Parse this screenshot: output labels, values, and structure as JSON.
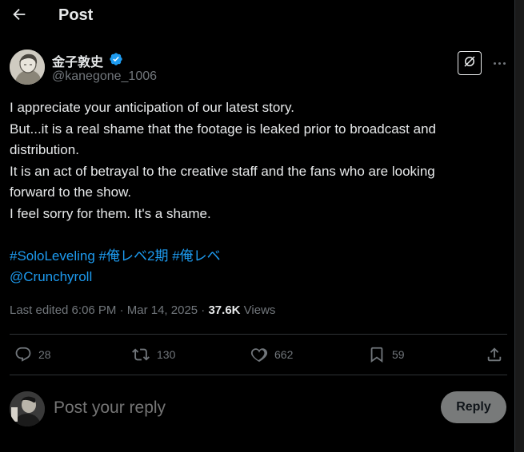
{
  "header": {
    "title": "Post",
    "back_icon": "arrow-left-icon"
  },
  "author": {
    "name": "金子敦史",
    "handle": "@kanegone_1006",
    "verified_color": "#1d9bf0"
  },
  "tweet": {
    "lines": [
      "I appreciate your anticipation of our latest story.",
      "But...it is a real shame that the footage is leaked prior to broadcast and",
      "distribution.",
      "It is an act of betrayal to the creative staff and the fans who are looking",
      "forward to the show.",
      "I feel sorry for them. It's a shame."
    ],
    "hashtags": [
      "#SoloLeveling",
      "#俺レベ2期",
      "#俺レベ"
    ],
    "mention": "@Crunchyroll"
  },
  "meta": {
    "edited": "Last edited 6:06 PM · Mar 14, 2025 · ",
    "views_count": "37.6K",
    "views_label": " Views"
  },
  "actions": {
    "replies": "28",
    "reposts": "130",
    "likes": "662",
    "bookmarks": "59"
  },
  "reply": {
    "placeholder": "Post your reply",
    "button_label": "Reply"
  },
  "colors": {
    "background": "#000000",
    "text": "#e7e9ea",
    "muted": "#71767b",
    "link": "#1d9bf0",
    "divider": "#2f3336",
    "reply_button": "#787a7a"
  }
}
